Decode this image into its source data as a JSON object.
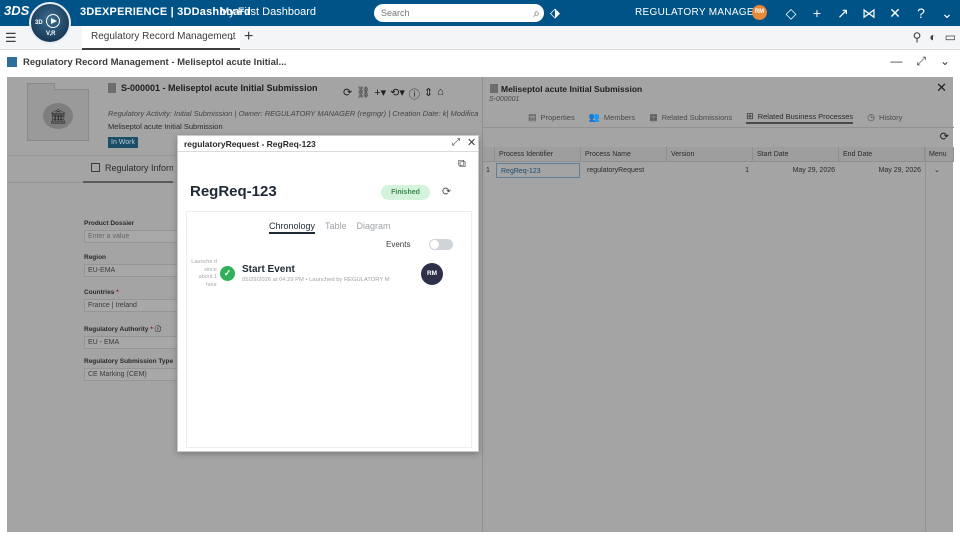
{
  "topbar": {
    "brand_bold": "3DEXPERIENCE | 3DDashboard",
    "dashboard_name": "My First Dashboard",
    "search_placeholder": "Search",
    "role": "REGULATORY MANAGER",
    "avatar_initials": "RM",
    "compass_3d": "3D",
    "compass_vr": "V,R"
  },
  "tabbar": {
    "active_tab": "Regulatory Record Management"
  },
  "widget": {
    "title": "Regulatory Record Management - Meliseptol acute Initial..."
  },
  "record": {
    "title": "S-000001 - Meliseptol acute Initial Submission",
    "subtitle": "Regulatory Activity: Initial Submission  |  Owner: REGULATORY MANAGER (regmgr)  |  Creation Date: k|  Modifica",
    "name": "Meliseptol acute Initial Submission",
    "state": "In Work",
    "info_tab": "Regulatory Informa"
  },
  "form": {
    "fields": [
      {
        "label": "Product Dossier",
        "value": "Enter a value",
        "placeholder": true,
        "required": false
      },
      {
        "label": "Region",
        "value": "EU-EMA",
        "required": false
      },
      {
        "label": "Countries",
        "value": "France | Ireland",
        "required": true
      },
      {
        "label": "Regulatory Authority",
        "value": "EU - EMA",
        "required": true
      },
      {
        "label": "Regulatory Submission Type",
        "value": "CE Marking (CEM)",
        "required": false
      }
    ]
  },
  "right_panel": {
    "title": "Meliseptol acute Initial Submission",
    "id": "S-000001",
    "tabs": [
      "Properties",
      "Members",
      "Related Submissions",
      "Related Business Processes",
      "History"
    ],
    "active_tab_index": 3,
    "grid": {
      "columns": [
        "Process Identifier",
        "Process Name",
        "Version",
        "Start Date",
        "End Date",
        "Menu"
      ],
      "rows": [
        {
          "index": "1",
          "identifier": "RegReq-123",
          "name": "regulatoryRequest",
          "version": "1",
          "start": "May 29, 2026",
          "end": "May 29, 2026"
        }
      ]
    }
  },
  "modal": {
    "title": "regulatoryRequest - RegReq-123",
    "heading": "RegReq-123",
    "status": "Finished",
    "colors": {
      "status_bg": "#d5f3dc",
      "status_fg": "#3a8a4e",
      "check": "#2fb15b"
    },
    "view_tabs": [
      "Chronology",
      "Table",
      "Diagram"
    ],
    "active_view": "Chronology",
    "events_label": "Events",
    "events_enabled": false,
    "timeline": [
      {
        "relative_time": "Launche d since about 1 hour",
        "title": "Start Event",
        "meta": "05/29/2026 at 04:29 PM • Launched by REGULATORY M",
        "avatar": "RM"
      }
    ]
  }
}
